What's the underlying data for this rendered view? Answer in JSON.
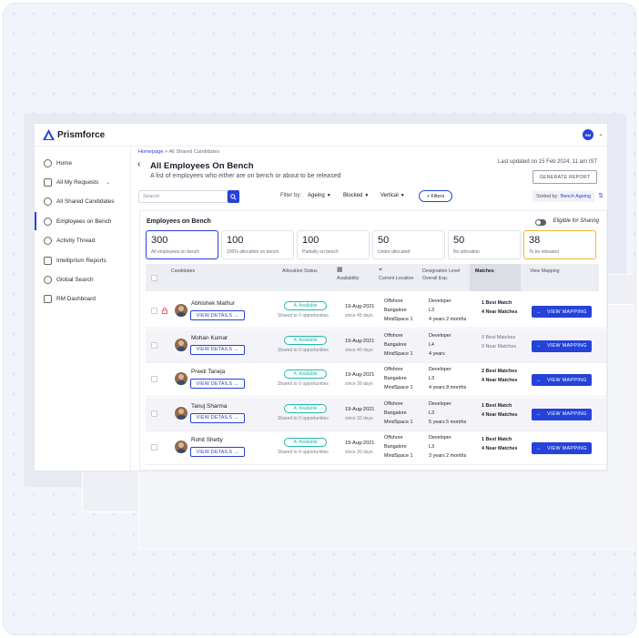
{
  "app": {
    "brand": "Prismforce",
    "avatar_initials": "RM"
  },
  "sidebar": {
    "items": [
      {
        "label": "Home",
        "icon": "home-icon"
      },
      {
        "label": "All My Requests",
        "icon": "requests-icon"
      },
      {
        "label": "All Shared Candidates",
        "icon": "user-icon"
      },
      {
        "label": "Employees on Bench",
        "icon": "user-icon",
        "active": true
      },
      {
        "label": "Activity Thread",
        "icon": "chat-icon"
      },
      {
        "label": "Intelliprism Reports",
        "icon": "reports-icon"
      },
      {
        "label": "Global Search",
        "icon": "globe-icon"
      },
      {
        "label": "RM Dashboard",
        "icon": "dashboard-icon"
      }
    ]
  },
  "breadcrumb": {
    "home": "Homepage",
    "sep": " > ",
    "current": "All Shared Candidates"
  },
  "header": {
    "title": "All Employees On Bench",
    "subtitle": "A list of employees who either are on bench or about to be released",
    "updated": "Last updated on 15 Feb 2024, 11 am IST",
    "generate_report": "GENERATE REPORT"
  },
  "toolbar": {
    "search_placeholder": "Search",
    "filter_by": "Filter by:",
    "filters": [
      "Ageing",
      "Blocked",
      "Vertical"
    ],
    "more_filters": "+ Filters",
    "sorted_label": "Sorted by:",
    "sorted_value": "Bench Ageing"
  },
  "panel": {
    "title": "Employees on Bench",
    "eligible_label": "Eligible for Sharing",
    "stats": [
      {
        "value": "300",
        "label": "All employees on bench"
      },
      {
        "value": "100",
        "label": "100% allocation on bench"
      },
      {
        "value": "100",
        "label": "Partially on bench"
      },
      {
        "value": "50",
        "label": "Under-allocated"
      },
      {
        "value": "50",
        "label": "No allocation"
      },
      {
        "value": "38",
        "label": "To be released"
      }
    ]
  },
  "table": {
    "headers": {
      "candidates": "Candidates",
      "allocation_status": "Allocation Status",
      "availability": "Availability",
      "current_location": "Current Location",
      "designation": "Designation Level Overall Exp.",
      "matches": "Matches",
      "view_mapping": "View Mapping"
    },
    "view_details": "VIEW DETAILS →",
    "view_mapping": "VIEW MAPPING",
    "rows": [
      {
        "name": "Abhishek Mathur",
        "status": "A: Available",
        "shared": "Shared to 0 opportunities",
        "date": "19-Aug-2021",
        "since": "since 45 days",
        "loc": [
          "Offshore",
          "Bangalore",
          "MindSpace 1"
        ],
        "des": [
          "Developer",
          "L3",
          "4 years 2 months"
        ],
        "m1": "1 Best Match",
        "m2": "4 Near Matches",
        "bold": true,
        "locked": true
      },
      {
        "name": "Mohan Kumar",
        "status": "A: Available",
        "shared": "Shared to 0 opportunities",
        "date": "19-Aug-2021",
        "since": "since 40 days",
        "loc": [
          "Offshore",
          "Bangalore",
          "MindSpace 1"
        ],
        "des": [
          "Developer",
          "L4",
          "4 years"
        ],
        "m1": "0 Best Matches",
        "m2": "0 Near Matches",
        "bold": false,
        "locked": false
      },
      {
        "name": "Preeti Taneja",
        "status": "A: Available",
        "shared": "Shared to 0 opportunities",
        "date": "19-Aug-2021",
        "since": "since 39 days",
        "loc": [
          "Offshore",
          "Bangalore",
          "MindSpace 1"
        ],
        "des": [
          "Developer",
          "L3",
          "4 years 8 months"
        ],
        "m1": "2 Best Matches",
        "m2": "4 Near Matches",
        "bold": true,
        "locked": false
      },
      {
        "name": "Tanuj Sharma",
        "status": "A: Available",
        "shared": "Shared to 0 opportunities",
        "date": "19-Aug-2021",
        "since": "since 32 days",
        "loc": [
          "Offshore",
          "Bangalore",
          "MindSpace 1"
        ],
        "des": [
          "Developer",
          "L3",
          "5 years 5 months"
        ],
        "m1": "1 Best Match",
        "m2": "4 Near Matches",
        "bold": true,
        "locked": false
      },
      {
        "name": "Rohit Shetty",
        "status": "A: Available",
        "shared": "Shared to 0 opportunities",
        "date": "19-Aug-2021",
        "since": "since 30 days",
        "loc": [
          "Offshore",
          "Bangalore",
          "MindSpace 1"
        ],
        "des": [
          "Developer",
          "L3",
          "3 years 2 months"
        ],
        "m1": "1 Best Match",
        "m2": "4 Near Matches",
        "bold": true,
        "locked": false
      }
    ]
  },
  "colors": {
    "primary": "#2542d9",
    "available": "#1fb8a9",
    "highlight": "#f2b62b"
  }
}
